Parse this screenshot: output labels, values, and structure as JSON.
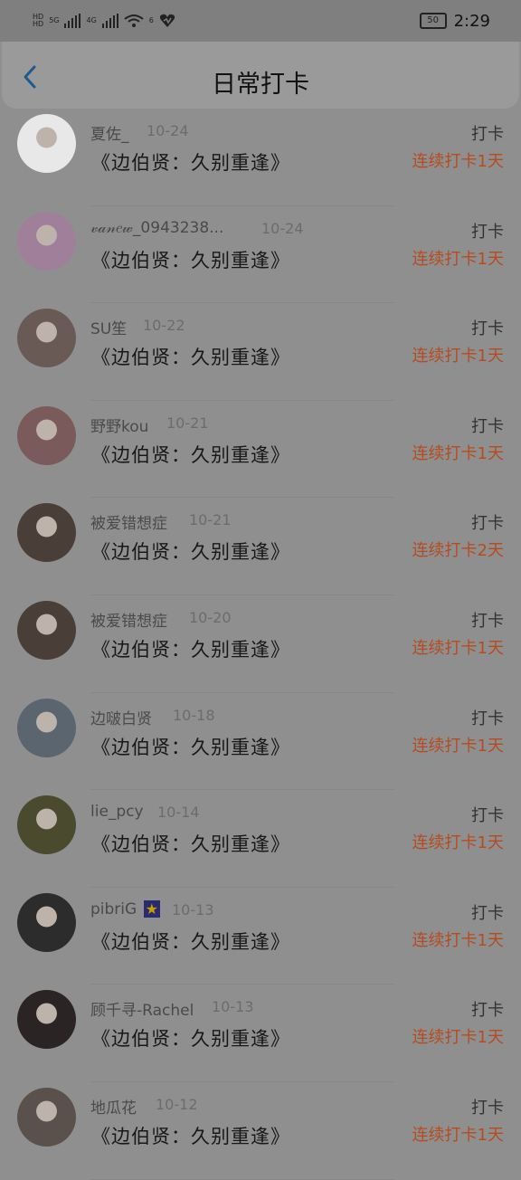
{
  "status": {
    "battery": "50",
    "time": "2:29",
    "net_labels": [
      "5G",
      "4G",
      "6"
    ]
  },
  "header": {
    "title": "日常打卡"
  },
  "rows": [
    {
      "name": "夏佐_",
      "date": "10-24",
      "book": "《边伯贤：久别重逢》",
      "check": "打卡",
      "streak": "连续打卡1天",
      "avatar_color": "#e8e8e8"
    },
    {
      "name": "𝓋𝒶𝓃𝑒𝓌_0943238...",
      "date": "10-24",
      "book": "《边伯贤：久别重逢》",
      "check": "打卡",
      "streak": "连续打卡1天",
      "avatar_color": "#9f7f9a"
    },
    {
      "name": "SU笙",
      "date": "10-22",
      "book": "《边伯贤：久别重逢》",
      "check": "打卡",
      "streak": "连续打卡1天",
      "avatar_color": "#6a5a55"
    },
    {
      "name": "野野kou",
      "date": "10-21",
      "book": "《边伯贤：久别重逢》",
      "check": "打卡",
      "streak": "连续打卡1天",
      "avatar_color": "#7a5a5a"
    },
    {
      "name": "被爱错想症",
      "date": "10-21",
      "book": "《边伯贤：久别重逢》",
      "check": "打卡",
      "streak": "连续打卡2天",
      "avatar_color": "#4a3e38"
    },
    {
      "name": "被爱错想症",
      "date": "10-20",
      "book": "《边伯贤：久别重逢》",
      "check": "打卡",
      "streak": "连续打卡1天",
      "avatar_color": "#4a3e38"
    },
    {
      "name": "边啵白贤",
      "date": "10-18",
      "book": "《边伯贤：久别重逢》",
      "check": "打卡",
      "streak": "连续打卡1天",
      "avatar_color": "#5a6570"
    },
    {
      "name": "lie_pcy",
      "date": "10-14",
      "book": "《边伯贤：久别重逢》",
      "check": "打卡",
      "streak": "连续打卡1天",
      "avatar_color": "#4a4a2e"
    },
    {
      "name": "pibriG",
      "date": "10-13",
      "book": "《边伯贤：久别重逢》",
      "check": "打卡",
      "streak": "连续打卡1天",
      "avatar_color": "#2c2c2c",
      "star": true
    },
    {
      "name": "顾千寻-Rachel",
      "date": "10-13",
      "book": "《边伯贤：久别重逢》",
      "check": "打卡",
      "streak": "连续打卡1天",
      "avatar_color": "#2a2424"
    },
    {
      "name": "地瓜花",
      "date": "10-12",
      "book": "《边伯贤：久别重逢》",
      "check": "打卡",
      "streak": "连续打卡1天",
      "avatar_color": "#5a504c"
    }
  ]
}
